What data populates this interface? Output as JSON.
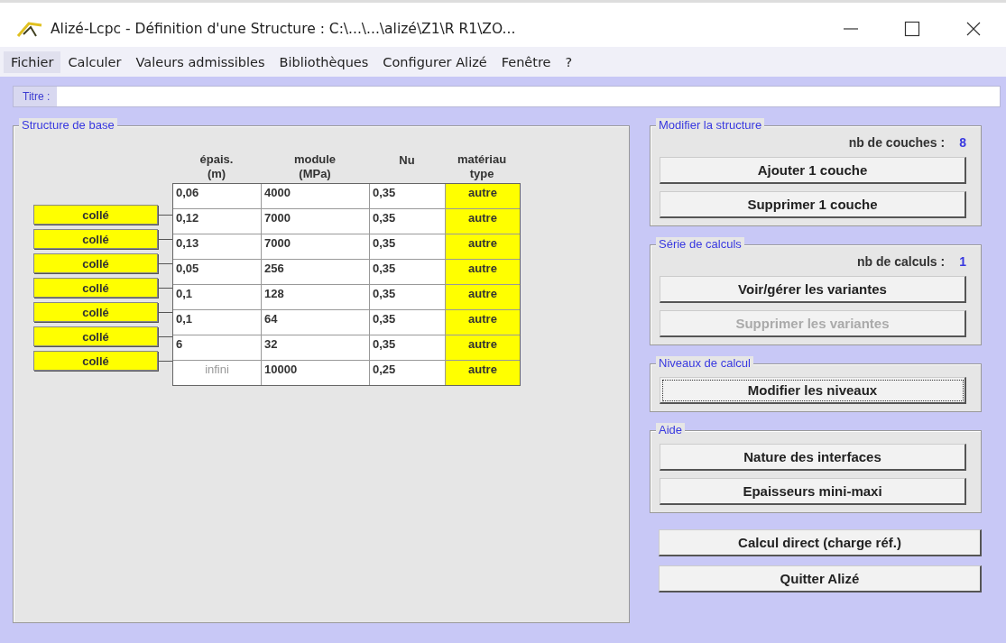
{
  "window": {
    "title": "Alizé-Lcpc - Définition d'une Structure : C:\\...\\...\\alizé\\Z1\\R R1\\ZO..."
  },
  "menu": [
    {
      "label": "Fichier",
      "selected": true
    },
    {
      "label": "Calculer",
      "selected": false
    },
    {
      "label": "Valeurs admissibles",
      "selected": false
    },
    {
      "label": "Bibliothèques",
      "selected": false
    },
    {
      "label": "Configurer Alizé",
      "selected": false
    },
    {
      "label": "Fenêtre",
      "selected": false
    },
    {
      "label": "?",
      "selected": false
    }
  ],
  "title_field": {
    "label": "Titre :"
  },
  "structure": {
    "title": "Structure de base",
    "columns": [
      [
        "épais.",
        "(m)"
      ],
      [
        "module",
        "(MPa)"
      ],
      [
        "Nu"
      ],
      [
        "matériau",
        "type"
      ]
    ],
    "interfaces": [
      {
        "label": "collé"
      },
      {
        "label": "collé"
      },
      {
        "label": "collé"
      },
      {
        "label": "collé"
      },
      {
        "label": "collé"
      },
      {
        "label": "collé"
      },
      {
        "label": "collé"
      }
    ],
    "rows": [
      {
        "thickness": "0,06",
        "thickness_disabled": false,
        "module": "4000",
        "nu": "0,35",
        "material": "autre"
      },
      {
        "thickness": "0,12",
        "thickness_disabled": false,
        "module": "7000",
        "nu": "0,35",
        "material": "autre"
      },
      {
        "thickness": "0,13",
        "thickness_disabled": false,
        "module": "7000",
        "nu": "0,35",
        "material": "autre"
      },
      {
        "thickness": "0,05",
        "thickness_disabled": false,
        "module": "256",
        "nu": "0,35",
        "material": "autre"
      },
      {
        "thickness": "0,1",
        "thickness_disabled": false,
        "module": "128",
        "nu": "0,35",
        "material": "autre"
      },
      {
        "thickness": "0,1",
        "thickness_disabled": false,
        "module": "64",
        "nu": "0,35",
        "material": "autre"
      },
      {
        "thickness": "6",
        "thickness_disabled": false,
        "module": "32",
        "nu": "0,35",
        "material": "autre"
      },
      {
        "thickness": "infini",
        "thickness_disabled": true,
        "module": "10000",
        "nu": "0,25",
        "material": "autre"
      }
    ]
  },
  "groups": [
    {
      "title": "Modifier la structure",
      "count_label": "nb de couches :",
      "count": "8",
      "buttons": [
        {
          "label": "Ajouter 1 couche",
          "disabled": false,
          "focused": false
        },
        {
          "label": "Supprimer 1 couche",
          "disabled": false,
          "focused": false
        }
      ]
    },
    {
      "title": "Série de calculs",
      "count_label": "nb de calculs :",
      "count": "1",
      "buttons": [
        {
          "label": "Voir/gérer les variantes",
          "disabled": false,
          "focused": false
        },
        {
          "label": "Supprimer les variantes",
          "disabled": true,
          "focused": false
        }
      ]
    },
    {
      "title": "Niveaux de calcul",
      "buttons": [
        {
          "label": "Modifier les niveaux",
          "disabled": false,
          "focused": true
        }
      ]
    },
    {
      "title": "Aide",
      "buttons": [
        {
          "label": "Nature des interfaces",
          "disabled": false,
          "focused": false
        },
        {
          "label": "Epaisseurs mini-maxi",
          "disabled": false,
          "focused": false
        }
      ]
    }
  ],
  "actions": [
    {
      "label": "Calcul direct (charge réf.)",
      "disabled": false,
      "focused": false
    },
    {
      "label": "Quitter Alizé",
      "disabled": false,
      "focused": false
    }
  ]
}
